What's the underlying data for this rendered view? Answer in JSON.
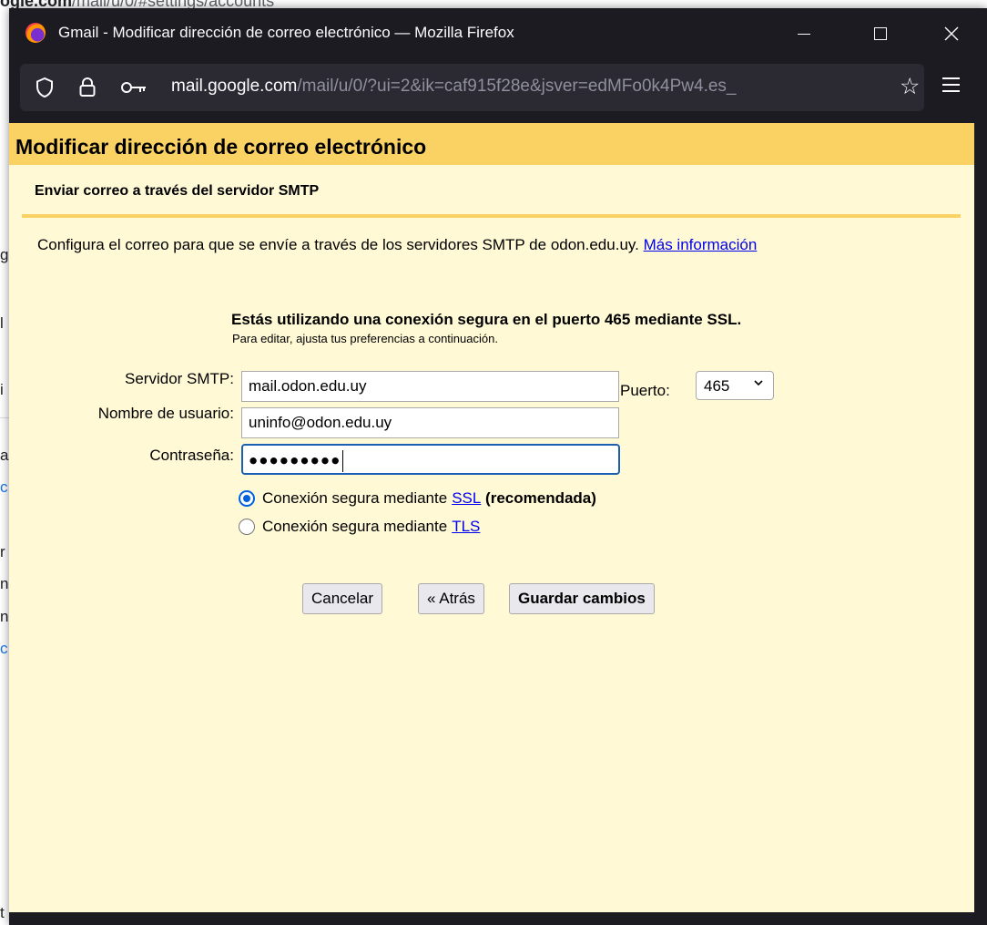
{
  "background": {
    "url_host": "ogle.com",
    "url_path": "/mail/u/0/#settings/accounts",
    "fragments": [
      "g",
      "l",
      "i",
      "a",
      "c",
      "r",
      "n",
      "n",
      "c",
      "t"
    ]
  },
  "window": {
    "title": "Gmail - Modificar dirección de correo electrónico — Mozilla Firefox",
    "controls": {
      "minimize": "minimize",
      "maximize": "maximize",
      "close": "close"
    }
  },
  "urlbar": {
    "host": "mail.google.com",
    "path": "/mail/u/0/?ui=2&ik=caf915f28e&jsver=edMFo0k4Pw4.es_"
  },
  "page": {
    "title": "Modificar dirección de correo electrónico",
    "section_title": "Enviar correo a través del servidor SMTP",
    "intro": "Configura el correo para que se envíe a través de los servidores SMTP de odon.edu.uy. ",
    "intro_link": "Más información",
    "secure_heading": "Estás utilizando una conexión segura en el puerto 465 mediante SSL.",
    "secure_sub": "Para editar, ajusta tus preferencias a continuación."
  },
  "form": {
    "smtp_label": "Servidor SMTP:",
    "smtp_value": "mail.odon.edu.uy",
    "port_label": "Puerto:",
    "port_value": "465",
    "user_label": "Nombre de usuario:",
    "user_value": "uninfo@odon.edu.uy",
    "password_label": "Contraseña:",
    "password_mask": "●●●●●●●●●",
    "ssl_option_prefix": "Conexión segura mediante ",
    "ssl_link": "SSL",
    "ssl_suffix": " (recomendada)",
    "tls_option_prefix": "Conexión segura mediante ",
    "tls_link": "TLS",
    "selected_security": "SSL"
  },
  "buttons": {
    "cancel": "Cancelar",
    "back": "« Atrás",
    "save": "Guardar cambios"
  },
  "colors": {
    "header_yellow": "#fad163",
    "panel_bg": "#fff9d6",
    "firefox_chrome": "#1c1b22",
    "link": "#0000ee"
  }
}
